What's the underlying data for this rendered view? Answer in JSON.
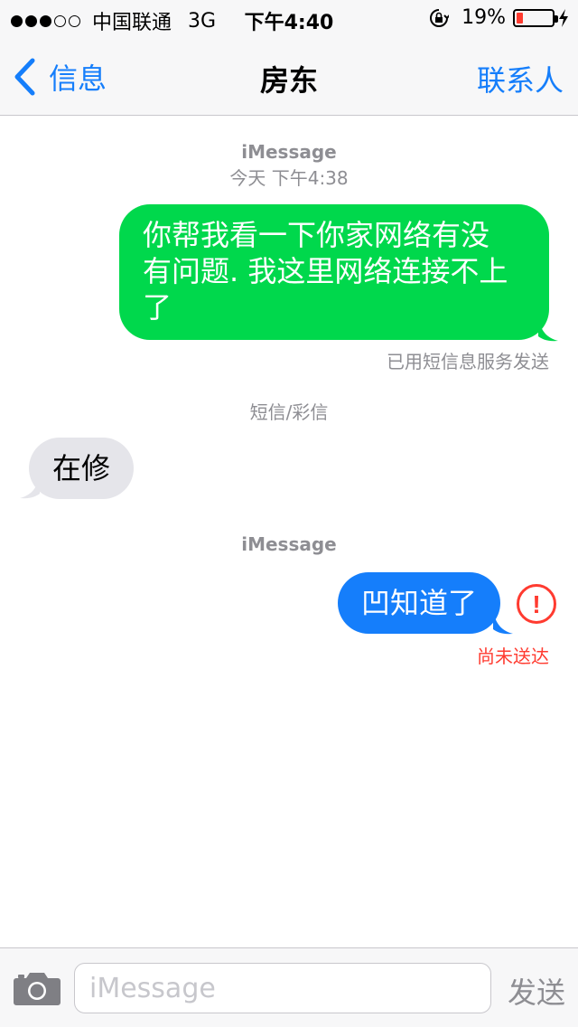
{
  "status_bar": {
    "signal_filled": 3,
    "signal_total": 5,
    "carrier": "中国联通",
    "network": "3G",
    "time": "下午4:40",
    "battery_percent": "19%",
    "battery_level": 0.19,
    "battery_color": "#ff3b30",
    "icons": [
      "rotation-lock-icon",
      "battery-icon",
      "charging-icon"
    ]
  },
  "nav": {
    "back_label": "信息",
    "title": "房东",
    "contact_label": "联系人",
    "accent": "#157efb"
  },
  "thread": {
    "section1": {
      "service": "iMessage",
      "timestamp": "今天 下午4:38"
    },
    "msg1": {
      "text_line1": "你帮我看一下你家网络有没",
      "text_line2": "有问题. 我这里网络连接不上",
      "text_line3": "了",
      "color": "#00d84c"
    },
    "msg1_note": "已用短信息服务发送",
    "section2": {
      "service": "短信/彩信"
    },
    "msg2": {
      "text": "在修",
      "color": "#e5e5ea"
    },
    "section3": {
      "service": "iMessage"
    },
    "msg3": {
      "text": "凹知道了",
      "color": "#157efb"
    },
    "msg3_error_mark": "!",
    "msg3_note": "尚未送达",
    "error_color": "#ff3b30"
  },
  "input_bar": {
    "placeholder": "iMessage",
    "send_label": "发送",
    "icons": [
      "camera-icon"
    ]
  }
}
